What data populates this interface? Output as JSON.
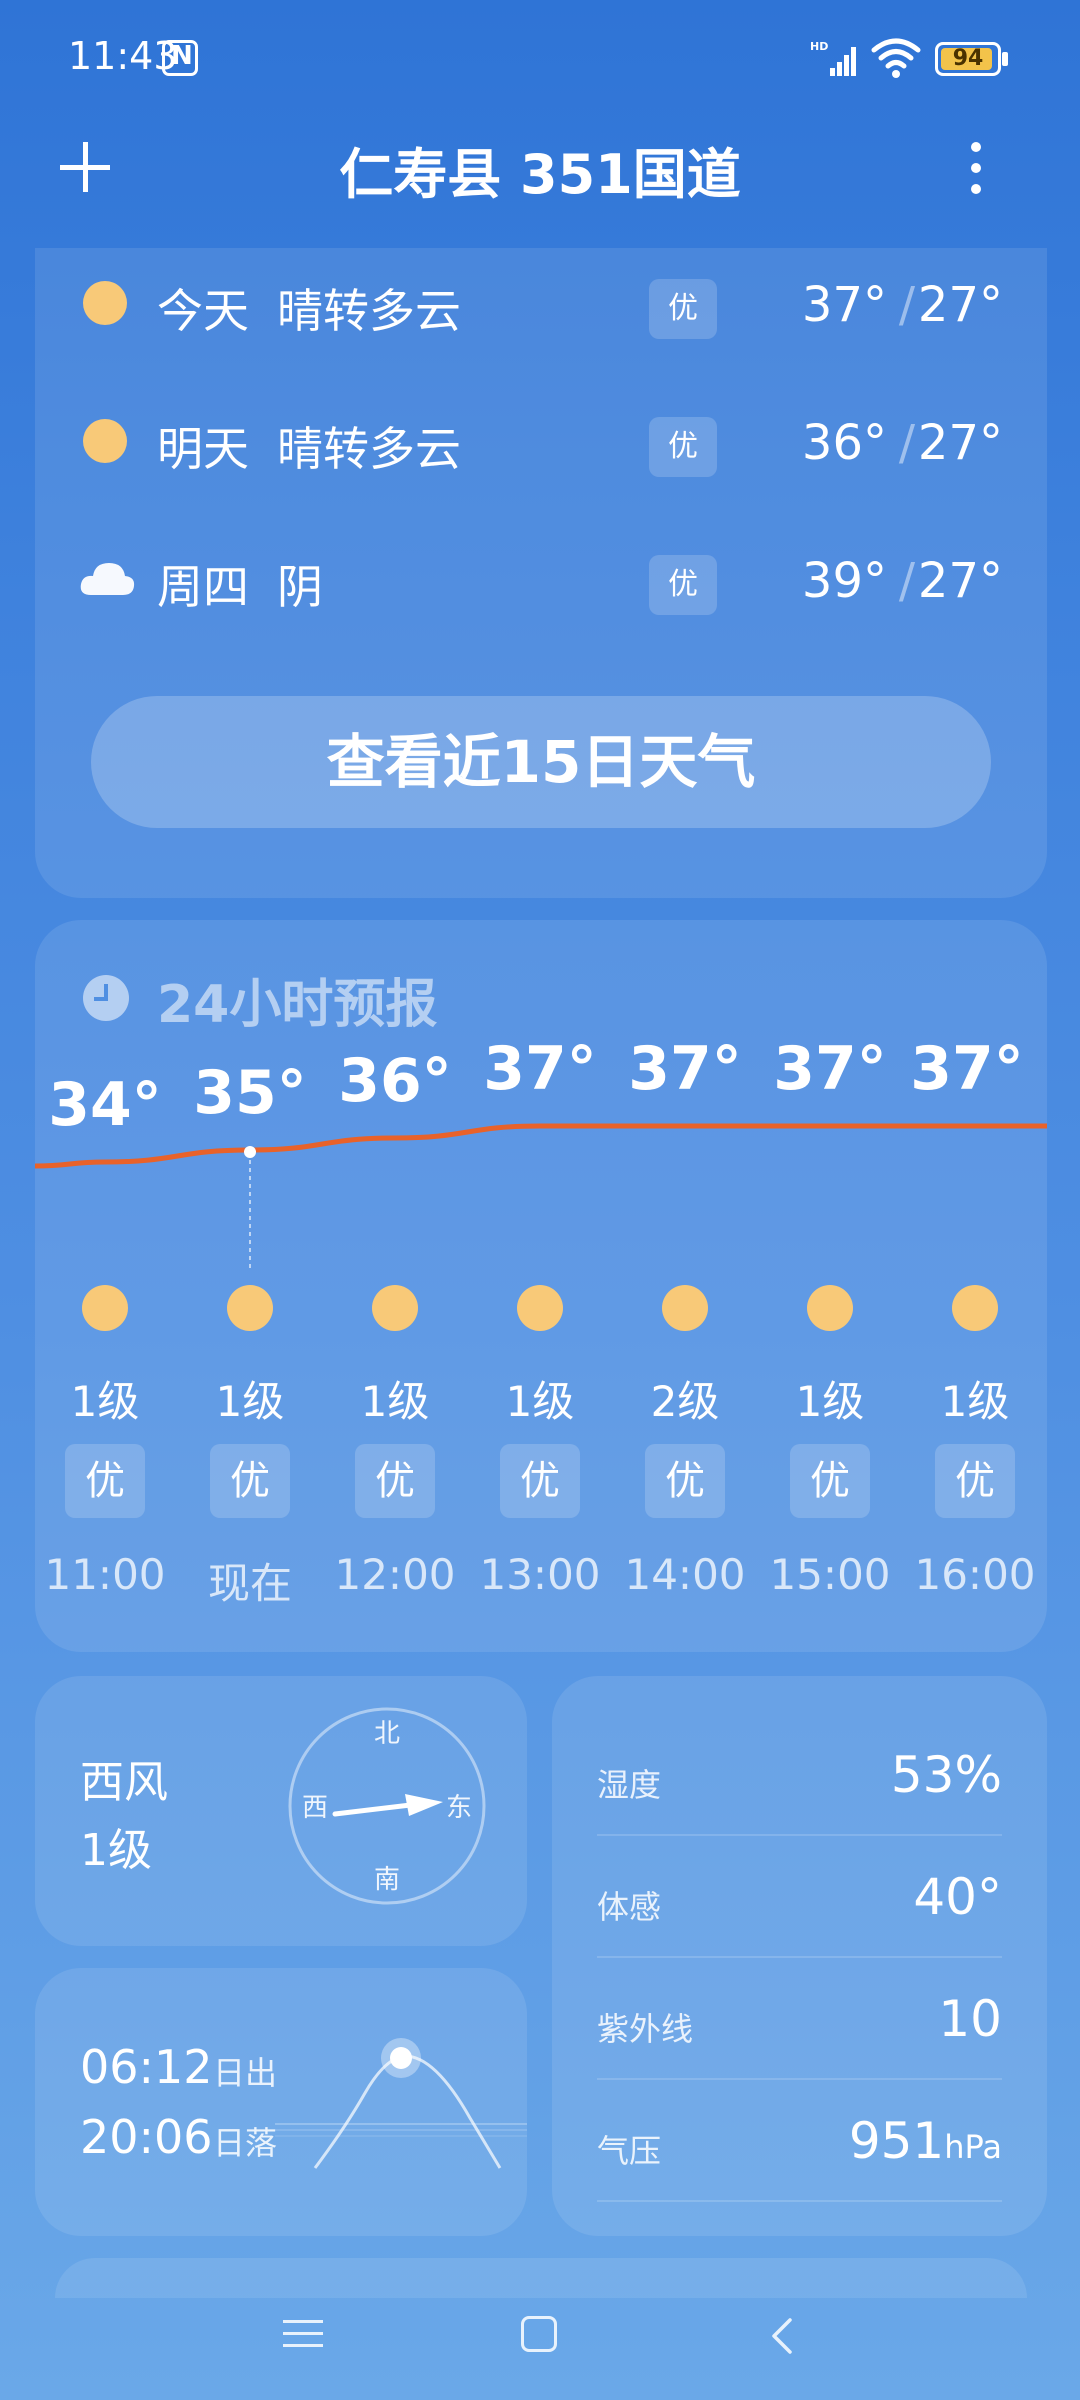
{
  "status_bar": {
    "time": "11:43",
    "battery": "94",
    "battery_level": 0.94
  },
  "header": {
    "title": "仁寿县 351国道"
  },
  "daily": [
    {
      "name": "今天",
      "condition": "晴转多云",
      "icon": "sun-icon",
      "aqi": "优",
      "high": "37°",
      "low": "27°"
    },
    {
      "name": "明天",
      "condition": "晴转多云",
      "icon": "sun-icon",
      "aqi": "优",
      "high": "36°",
      "low": "27°"
    },
    {
      "name": "周四",
      "condition": "阴",
      "icon": "cloud-icon",
      "aqi": "优",
      "high": "39°",
      "low": "27°"
    }
  ],
  "temp_sep": "/",
  "cta": {
    "label": "查看近15日天气"
  },
  "hourly": {
    "title": "24小时预报",
    "hours": [
      {
        "temp": "34°",
        "temp_value": 34,
        "wind": "1级",
        "aqi": "优",
        "time": "11:00"
      },
      {
        "temp": "35°",
        "temp_value": 35,
        "wind": "1级",
        "aqi": "优",
        "time": "现在"
      },
      {
        "temp": "36°",
        "temp_value": 36,
        "wind": "1级",
        "aqi": "优",
        "time": "12:00"
      },
      {
        "temp": "37°",
        "temp_value": 37,
        "wind": "1级",
        "aqi": "优",
        "time": "13:00"
      },
      {
        "temp": "37°",
        "temp_value": 37,
        "wind": "2级",
        "aqi": "优",
        "time": "14:00"
      },
      {
        "temp": "37°",
        "temp_value": 37,
        "wind": "1级",
        "aqi": "优",
        "time": "15:00"
      },
      {
        "temp": "37°",
        "temp_value": 37,
        "wind": "1级",
        "aqi": "优",
        "time": "16:00"
      }
    ],
    "line_color": "#e8622a"
  },
  "wind": {
    "direction": "西风",
    "level": "1级",
    "north": "北",
    "south": "南",
    "west": "西",
    "east": "东"
  },
  "sun": {
    "sunrise_time": "06:12",
    "sunrise_label": "日出",
    "sunset_time": "20:06",
    "sunset_label": "日落"
  },
  "details": [
    {
      "label": "湿度",
      "value": "53%",
      "unit": ""
    },
    {
      "label": "体感",
      "value": "40°",
      "unit": ""
    },
    {
      "label": "紫外线",
      "value": "10",
      "unit": ""
    },
    {
      "label": "气压",
      "value": "951",
      "unit": "hPa"
    }
  ],
  "colors": {
    "sun": "#f8c978",
    "background_top": "#2f74d6",
    "background_bottom": "#6aa8e8"
  }
}
